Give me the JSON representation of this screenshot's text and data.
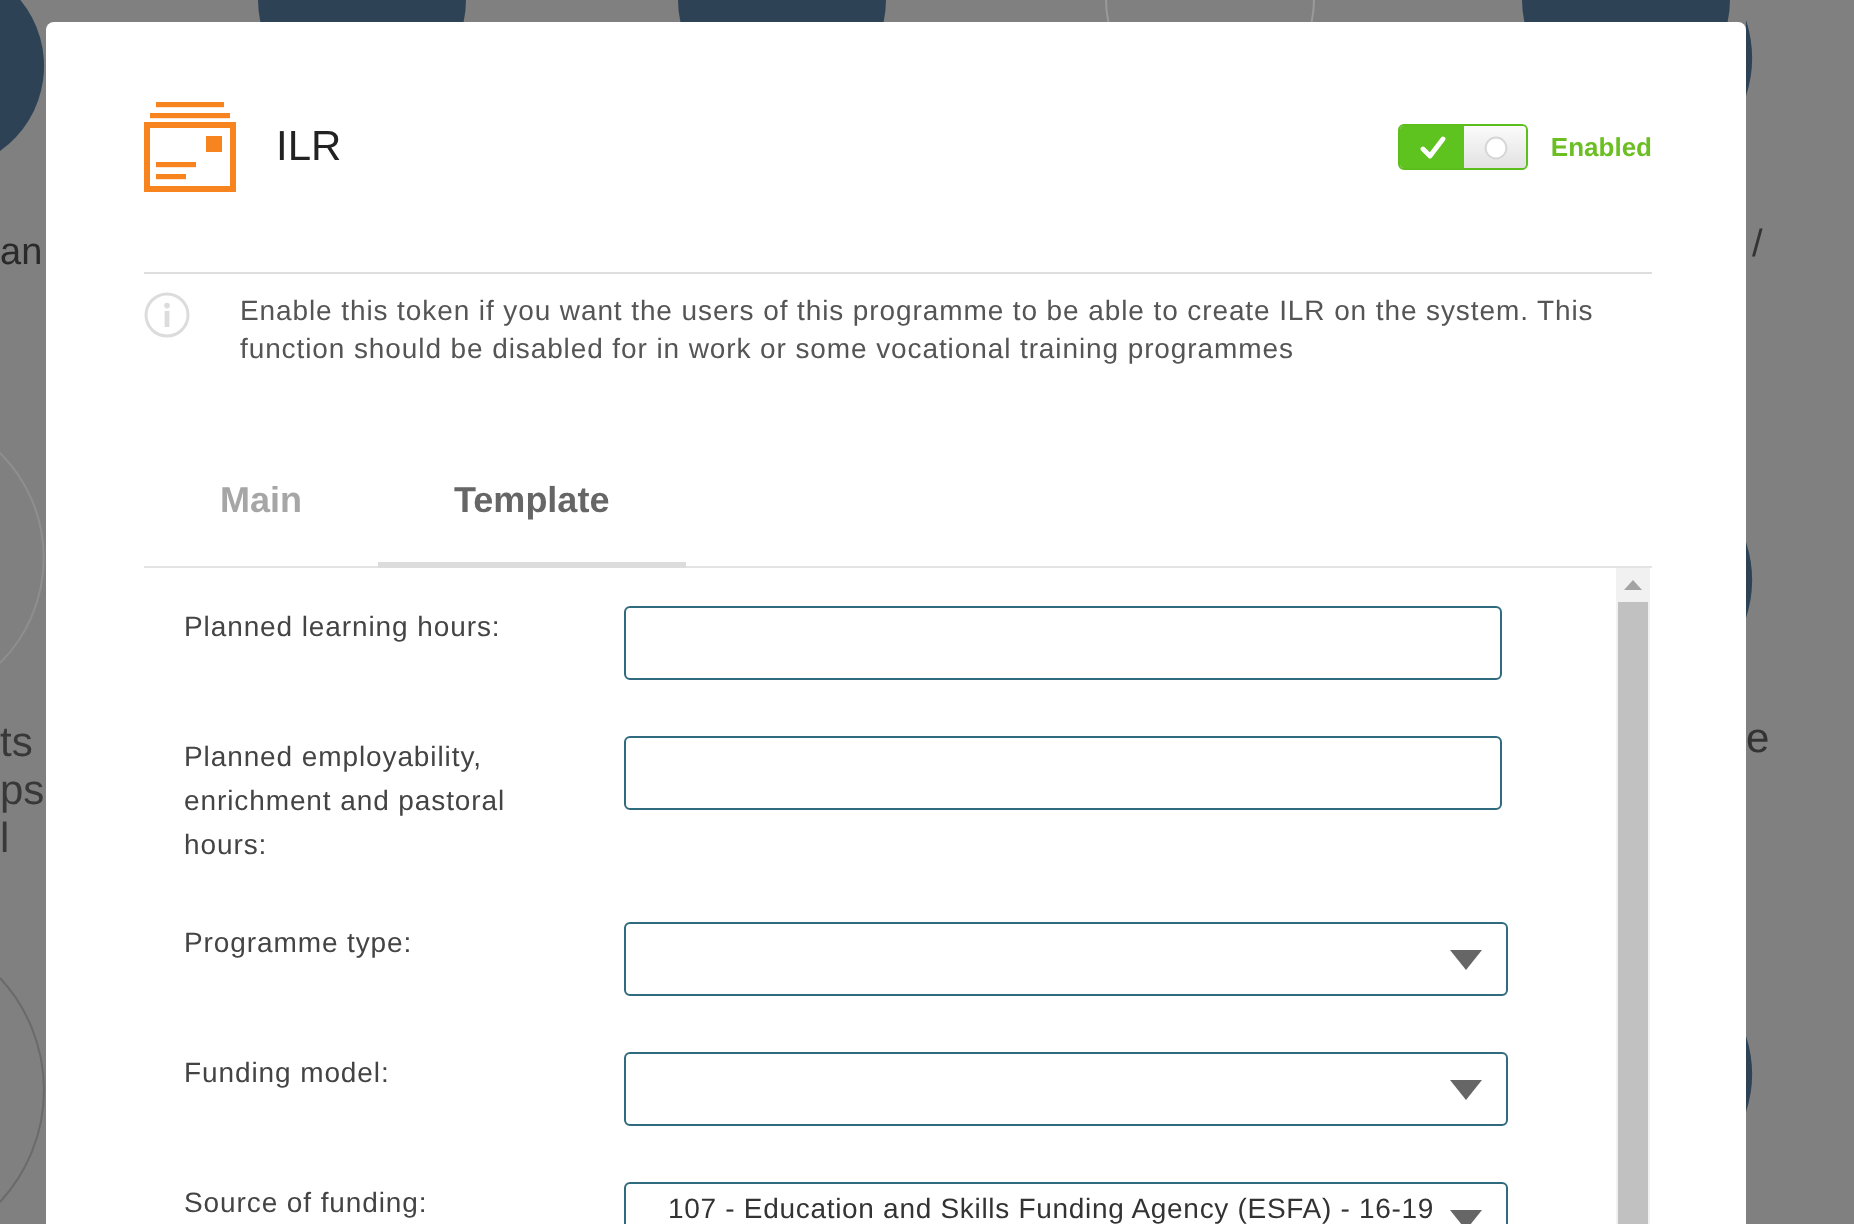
{
  "backdrop": {
    "left_texts": [
      "an",
      "ts",
      "ps",
      "l"
    ],
    "right_texts": [
      "/",
      "e"
    ]
  },
  "dialog": {
    "title": "ILR",
    "toggle": {
      "on": true,
      "label": "Enabled"
    },
    "info": "Enable this token if you want the users of this programme to be able to create ILR on the system. This function should be disabled for in work or some vocational training programmes",
    "tabs": [
      {
        "label": "Main",
        "selected": false
      },
      {
        "label": "Template",
        "selected": true
      }
    ],
    "fields": [
      {
        "kind": "text",
        "label": "Planned learning hours:"
      },
      {
        "kind": "text",
        "label": "Planned employability, enrichment and pastoral hours:"
      },
      {
        "kind": "select",
        "label": "Programme type:"
      },
      {
        "kind": "select",
        "label": "Funding model:"
      },
      {
        "kind": "select",
        "label": "Source of funding:",
        "value": "107 - Education and Skills Funding Agency (ESFA) - 16-19"
      }
    ]
  }
}
